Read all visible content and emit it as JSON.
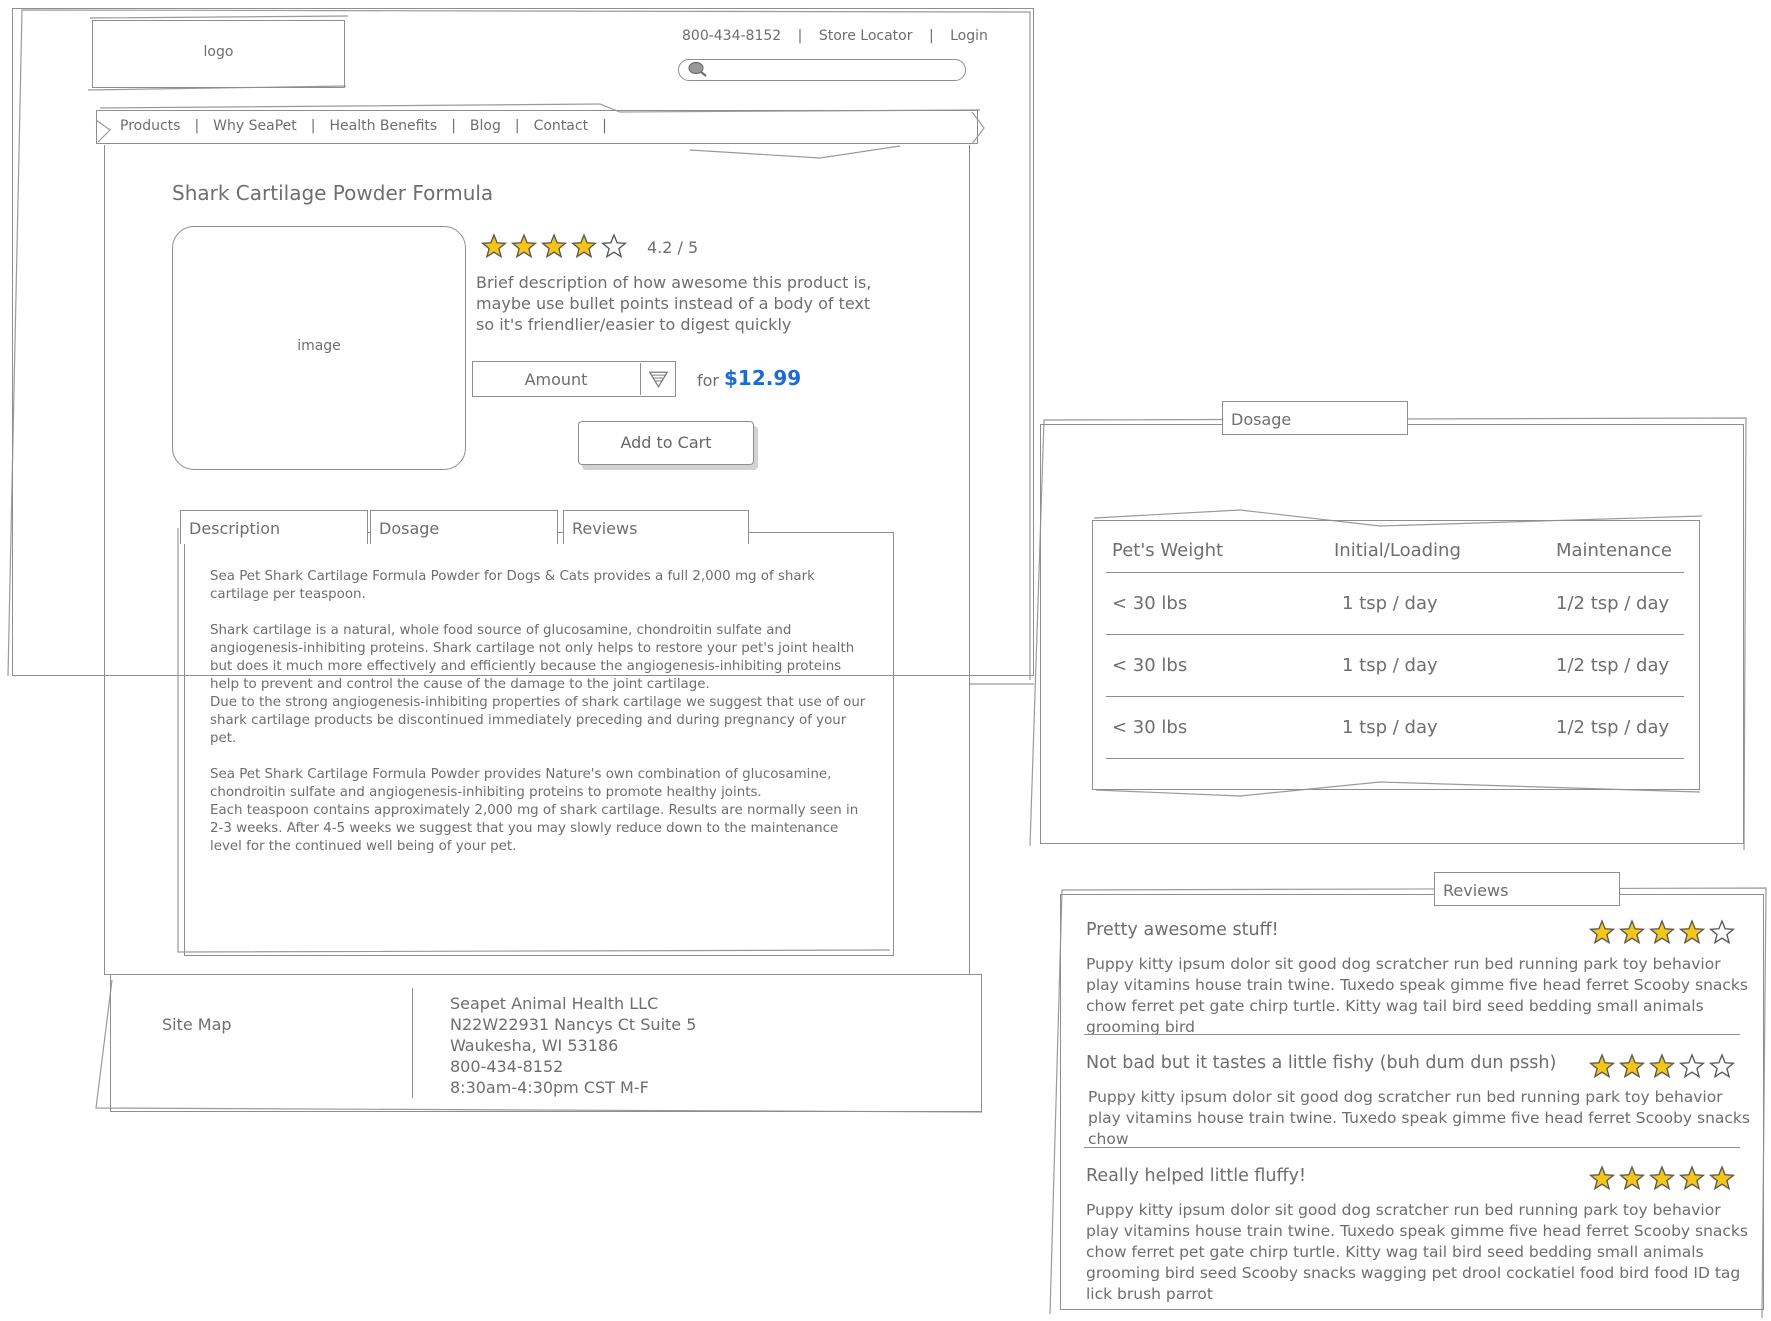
{
  "header": {
    "logo_label": "logo",
    "phone": "800-434-8152",
    "store_locator": "Store Locator",
    "login": "Login",
    "separator": "|",
    "search_placeholder": ""
  },
  "nav": {
    "items": [
      "Products",
      "Why SeaPet",
      "Health Benefits",
      "Blog",
      "Contact"
    ],
    "separator": "|"
  },
  "product": {
    "title": "Shark Cartilage Powder Formula",
    "image_label": "image",
    "rating_text": "4.2 / 5",
    "rating_value": 4.2,
    "rating_max": 5,
    "description": "Brief description of how awesome this product is, maybe use bullet points instead of a body of text so it's friendlier/easier to digest quickly",
    "amount_label": "Amount",
    "price_prefix": "for",
    "price": "$12.99",
    "add_to_cart": "Add to Cart"
  },
  "tabs": {
    "items": [
      "Description",
      "Dosage",
      "Reviews"
    ],
    "description_paragraphs": [
      "Sea Pet Shark Cartilage Formula Powder for Dogs & Cats provides a full 2,000 mg of shark cartilage per teaspoon.",
      "Shark cartilage is a natural, whole food source of glucosamine, chondroitin sulfate and angiogenesis-inhibiting proteins.  Shark cartilage not only helps to restore your pet's joint health but does it much more effectively and efficiently because the angiogenesis-inhibiting proteins help to prevent and control the cause of the damage to the joint cartilage.\nDue to the strong angiogenesis-inhibiting properties of shark cartilage we suggest that use of our shark cartilage products be discontinued immediately preceding and during pregnancy of your pet.",
      "Sea Pet Shark Cartilage Formula Powder provides Nature's own combination of glucosamine, chondroitin sulfate and angiogenesis-inhibiting proteins to promote healthy joints.\nEach teaspoon contains approximately 2,000 mg of shark cartilage.  Results are normally seen in 2-3 weeks.  After 4-5 weeks we suggest that you may slowly reduce down to the maintenance level for the continued well being of your pet."
    ]
  },
  "footer": {
    "site_map": "Site Map",
    "company": "Seapet Animal Health LLC",
    "street": "N22W22931 Nancys Ct Suite 5",
    "city": "Waukesha, WI 53186",
    "phone": "800-434-8152",
    "hours": "8:30am-4:30pm CST M-F"
  },
  "dosage": {
    "tab_label": "Dosage",
    "headers": [
      "Pet's Weight",
      "Initial/Loading",
      "Maintenance"
    ],
    "rows": [
      [
        "< 30 lbs",
        "1 tsp / day",
        "1/2 tsp / day"
      ],
      [
        "< 30 lbs",
        "1 tsp / day",
        "1/2 tsp / day"
      ],
      [
        "< 30 lbs",
        "1 tsp / day",
        "1/2 tsp / day"
      ]
    ]
  },
  "reviews": {
    "tab_label": "Reviews",
    "items": [
      {
        "title": "Pretty awesome stuff!",
        "stars": 4,
        "body": "Puppy kitty ipsum dolor sit good dog scratcher run bed running park toy behavior play vitamins house train twine. Tuxedo speak gimme five head ferret Scooby snacks chow ferret pet gate chirp turtle. Kitty wag tail bird seed bedding small animals grooming bird"
      },
      {
        "title": "Not bad but it tastes a little fishy (buh dum dun pssh)",
        "stars": 3,
        "body": "Puppy kitty ipsum dolor sit good dog scratcher run bed running park toy behavior play vitamins house train twine. Tuxedo speak gimme five head ferret Scooby snacks chow"
      },
      {
        "title": "Really helped little fluffy!",
        "stars": 5,
        "body": "Puppy kitty ipsum dolor sit good dog scratcher run bed running park toy behavior play vitamins house train twine. Tuxedo speak gimme five head ferret Scooby snacks chow ferret pet gate chirp turtle. Kitty wag tail bird seed bedding small animals grooming bird seed Scooby snacks wagging pet drool cockatiel food bird food ID tag lick brush parrot"
      }
    ]
  },
  "colors": {
    "price": "#1e6ad4",
    "star_filled": "#f5c518",
    "star_empty": "#ffffff",
    "sketch_line": "#8e8e8e",
    "text": "#6e6e6e"
  }
}
